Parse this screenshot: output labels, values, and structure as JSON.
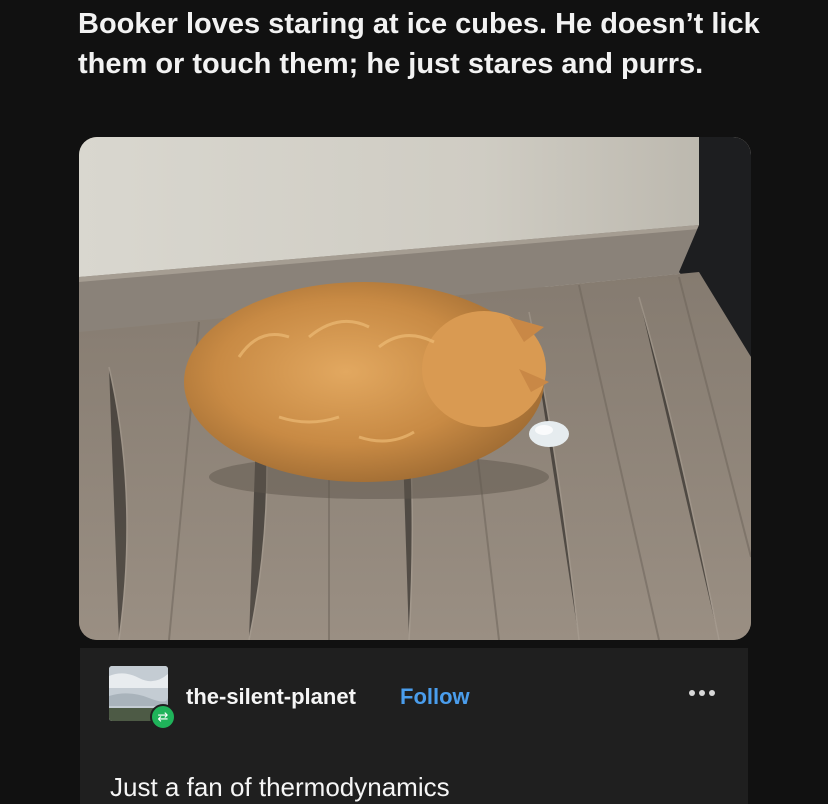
{
  "post": {
    "caption": "Booker loves staring at ice cubes. He doesn’t lick them or touch them; he just stares and purrs.",
    "image_icon": "photo-of-cat-staring-at-ice-cube"
  },
  "reblog": {
    "username": "the-silent-planet",
    "follow_label": "Follow",
    "comment": "Just a fan of thermodynamics",
    "avatar_icon": "sky-landscape-avatar",
    "badge_icon": "reblog-icon",
    "more_icon": "ellipsis-icon"
  },
  "colors": {
    "background": "#111111",
    "panel": "#1f1f1f",
    "follow_link": "#4a9dec",
    "reblog_badge": "#1fb35a"
  }
}
